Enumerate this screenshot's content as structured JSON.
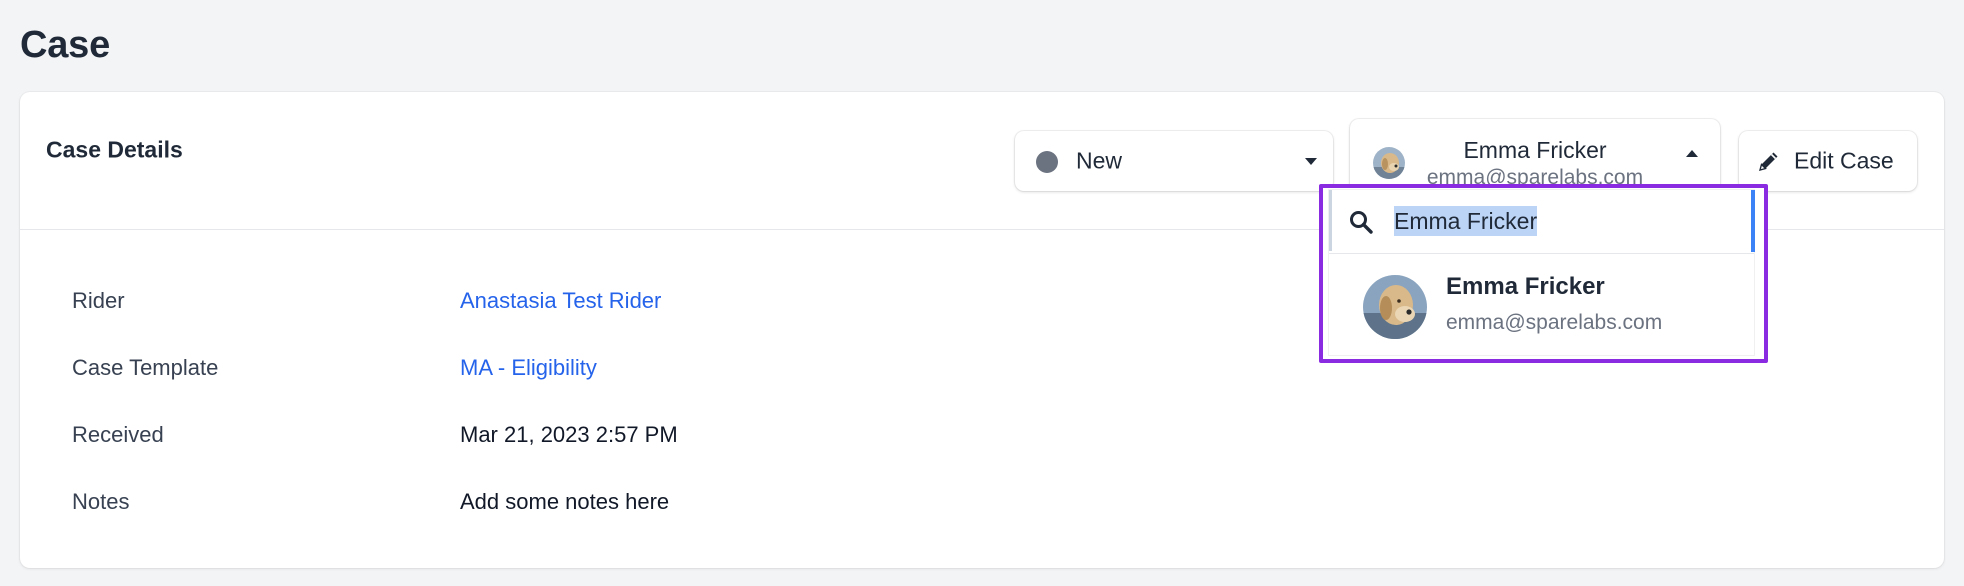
{
  "page": {
    "title": "Case"
  },
  "card": {
    "title": "Case Details"
  },
  "status": {
    "label": "New",
    "dot_color": "#6b7280"
  },
  "assignee": {
    "name": "Emma Fricker",
    "email": "emma@sparelabs.com"
  },
  "edit": {
    "label": "Edit Case",
    "icon": "pencil-icon"
  },
  "dropdown": {
    "search_value": "Emma Fricker",
    "search_icon": "search-icon",
    "highlight_color": "#8a2be2",
    "options": [
      {
        "name": "Emma Fricker",
        "email": "emma@sparelabs.com"
      }
    ]
  },
  "details": [
    {
      "label": "Rider",
      "value": "Anastasia Test Rider",
      "link": true
    },
    {
      "label": "Case Template",
      "value": "MA - Eligibility",
      "link": true
    },
    {
      "label": "Received",
      "value": "Mar 21, 2023 2:57 PM",
      "link": false
    },
    {
      "label": "Notes",
      "value": "Add some notes here",
      "link": false
    }
  ],
  "colors": {
    "link": "#2563eb",
    "background": "#f3f4f6",
    "text": "#1f2937"
  }
}
